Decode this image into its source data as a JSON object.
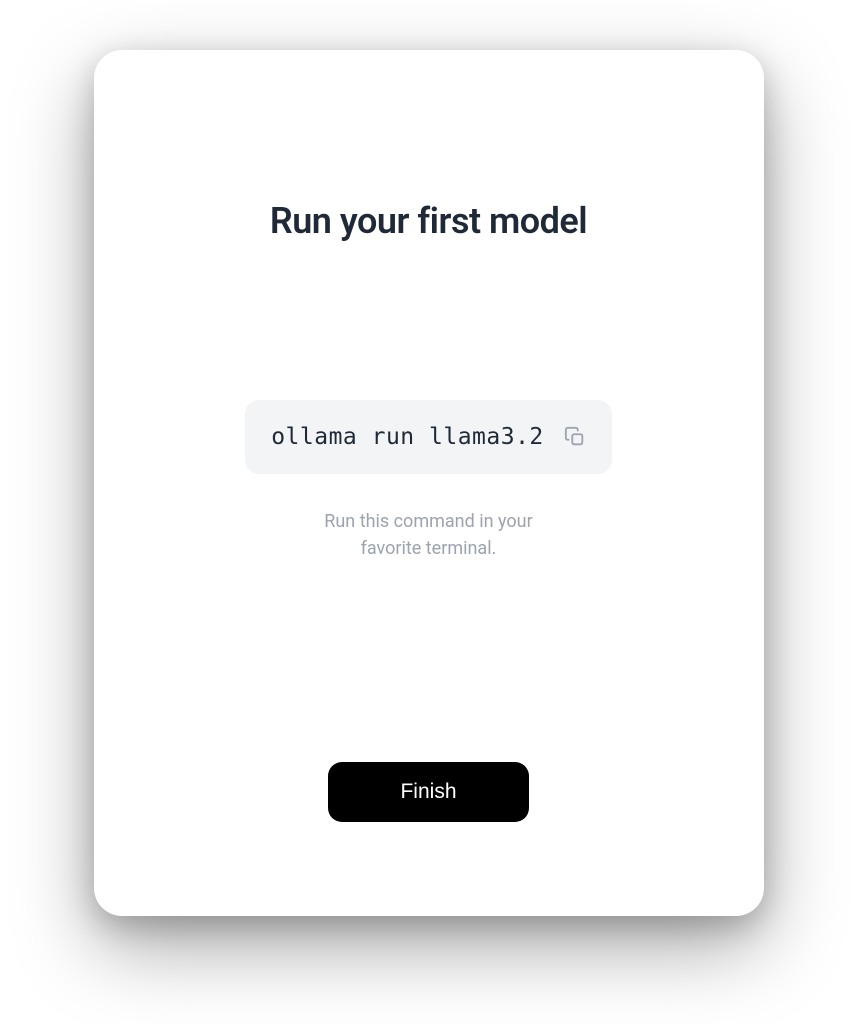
{
  "title": "Run your first model",
  "command": "ollama run llama3.2",
  "helper_line1": "Run this command in your",
  "helper_line2": "favorite terminal.",
  "finish_label": "Finish"
}
